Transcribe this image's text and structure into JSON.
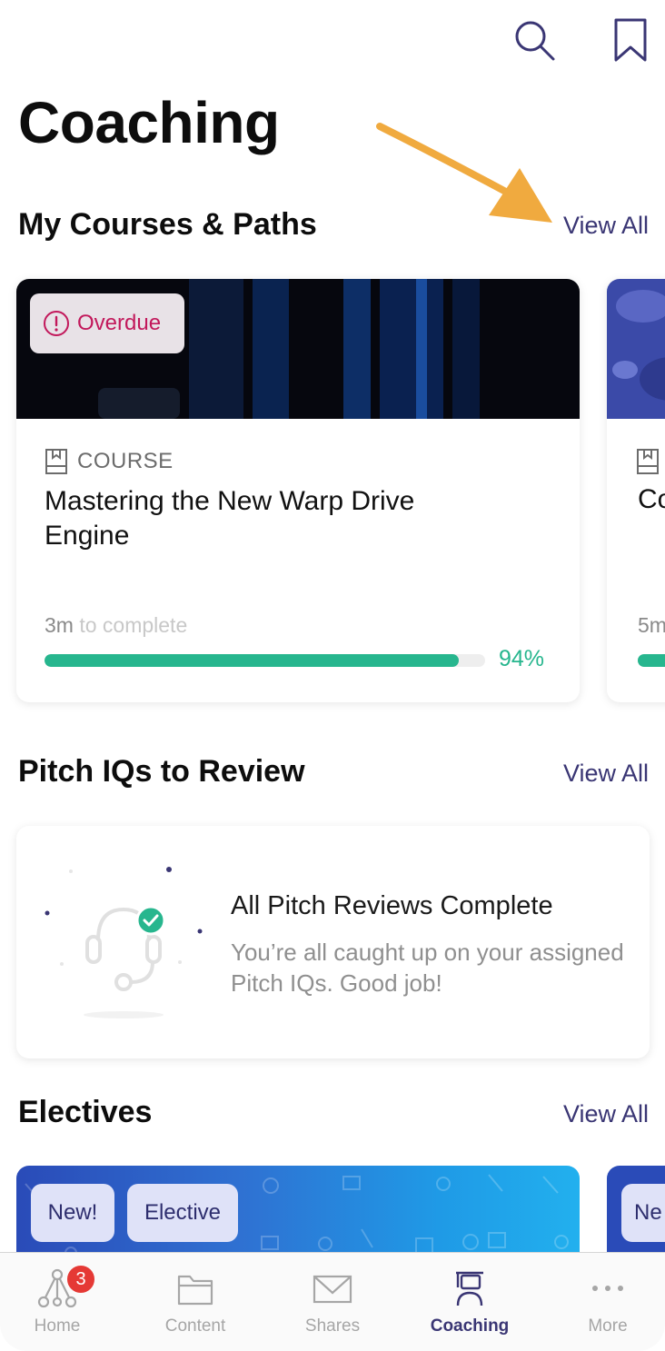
{
  "header": {
    "title": "Coaching",
    "icons": [
      "search-icon",
      "bookmark-icon"
    ]
  },
  "colors": {
    "accent": "#3a3674",
    "progress": "#27b68e",
    "overdue": "#c2185b",
    "badge": "#e53935",
    "annotation_arrow": "#f0aa3f"
  },
  "courses": {
    "title": "My Courses & Paths",
    "view_all": "View All",
    "items": [
      {
        "status": "Overdue",
        "type": "COURSE",
        "title": "Mastering the New Warp Drive Engine",
        "duration_value": "3m",
        "duration_suffix": "to complete",
        "progress": 0.94,
        "progress_label": "94%"
      },
      {
        "type_icon": "book-icon",
        "title_partial": "Co",
        "duration_partial": "5m"
      }
    ]
  },
  "pitch": {
    "title": "Pitch IQs to Review",
    "view_all": "View All",
    "empty_title": "All Pitch Reviews Complete",
    "empty_message": "You’re all caught up on your assigned Pitch IQs. Good job!"
  },
  "electives": {
    "title": "Electives",
    "view_all": "View All",
    "tags": [
      "New!",
      "Elective"
    ],
    "tag_partial": "Ne"
  },
  "tabbar": {
    "active": "Coaching",
    "items": [
      {
        "label": "Home",
        "icon": "network-icon",
        "badge": "3"
      },
      {
        "label": "Content",
        "icon": "folder-icon"
      },
      {
        "label": "Shares",
        "icon": "envelope-icon"
      },
      {
        "label": "Coaching",
        "icon": "coach-icon"
      },
      {
        "label": "More",
        "icon": "ellipsis-icon"
      }
    ]
  }
}
